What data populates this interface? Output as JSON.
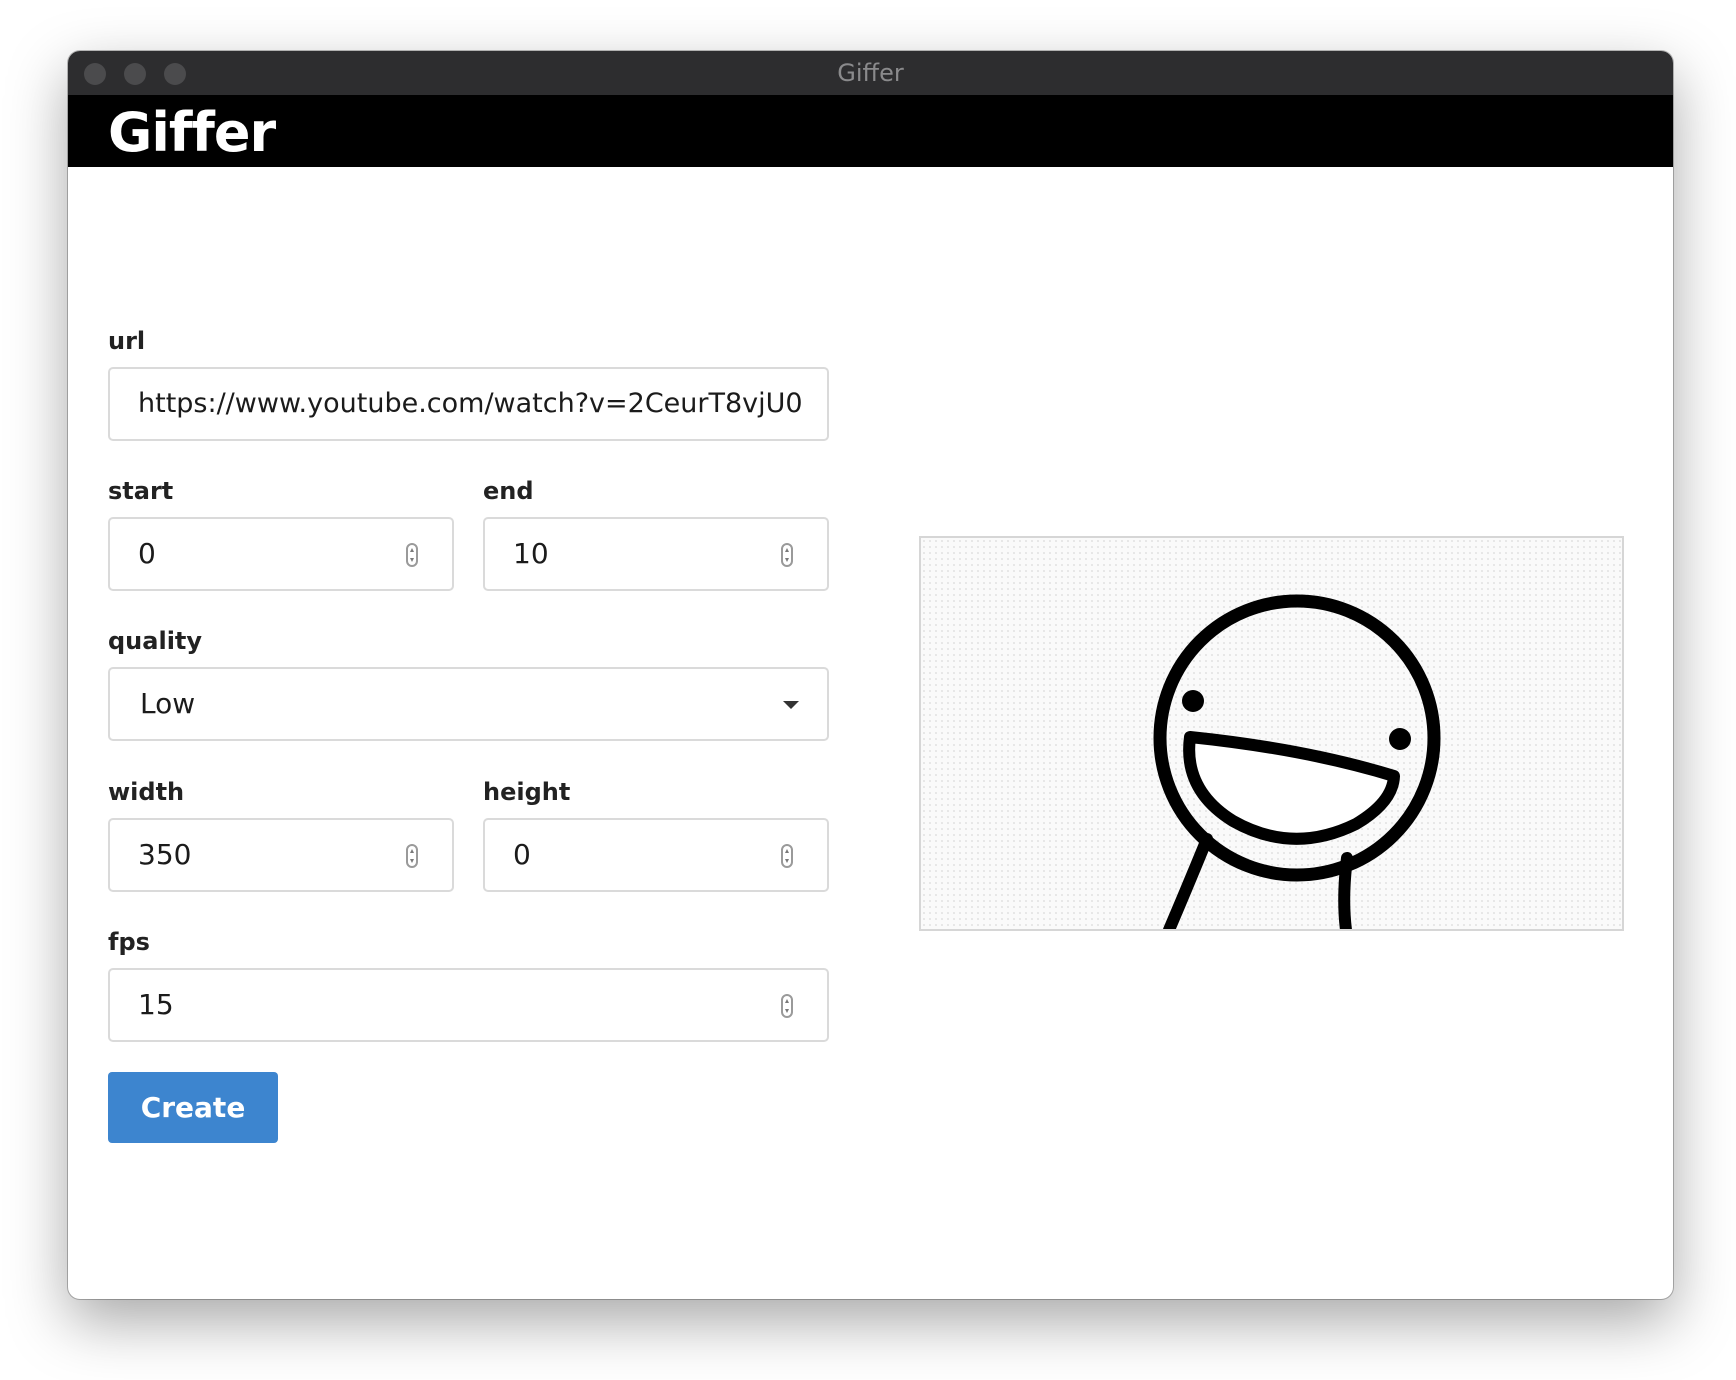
{
  "window": {
    "title": "Giffer"
  },
  "header": {
    "title": "Giffer"
  },
  "form": {
    "url": {
      "label": "url",
      "value": "https://www.youtube.com/watch?v=2CeurT8vjU0"
    },
    "start": {
      "label": "start",
      "value": "0"
    },
    "end": {
      "label": "end",
      "value": "10"
    },
    "quality": {
      "label": "quality",
      "selected": "Low"
    },
    "width": {
      "label": "width",
      "value": "350"
    },
    "height": {
      "label": "height",
      "value": "0"
    },
    "fps": {
      "label": "fps",
      "value": "15"
    },
    "create_label": "Create"
  },
  "colors": {
    "header_background": "#000000",
    "titlebar_background": "#2d2d2f",
    "primary_button": "#3d85cf"
  },
  "icons": {
    "spinner": "stepper-arrows-icon",
    "dropdown": "chevron-down-icon",
    "window_controls": [
      "close-button",
      "minimize-button",
      "zoom-button"
    ]
  },
  "preview": {
    "content": "gif-preview-smiling-cartoon-character"
  }
}
